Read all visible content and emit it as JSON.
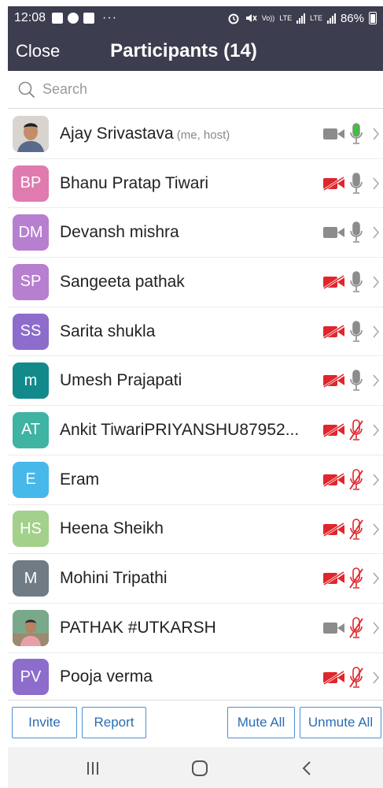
{
  "status_bar": {
    "time": "12:08",
    "dots": "···",
    "volte": "Vo))",
    "lte1": "LTE",
    "lte2": "LTE",
    "battery": "86%"
  },
  "header": {
    "close_label": "Close",
    "title": "Participants (14)"
  },
  "search": {
    "placeholder": "Search"
  },
  "participants": [
    {
      "name": "Ajay Srivastava",
      "tag": "(me, host)",
      "initials": "",
      "avatar_color": "#c8c8c8",
      "photo": true,
      "video_on": true,
      "mic_state": "on"
    },
    {
      "name": "Bhanu Pratap Tiwari",
      "tag": "",
      "initials": "BP",
      "avatar_color": "#e07bb0",
      "photo": false,
      "video_on": false,
      "mic_state": "unmuted"
    },
    {
      "name": "Devansh mishra",
      "tag": "",
      "initials": "DM",
      "avatar_color": "#b77fd0",
      "photo": false,
      "video_on": true,
      "mic_state": "unmuted"
    },
    {
      "name": "Sangeeta pathak",
      "tag": "",
      "initials": "SP",
      "avatar_color": "#b77fd0",
      "photo": false,
      "video_on": false,
      "mic_state": "unmuted"
    },
    {
      "name": "Sarita shukla",
      "tag": "",
      "initials": "SS",
      "avatar_color": "#8e6ccc",
      "photo": false,
      "video_on": false,
      "mic_state": "unmuted"
    },
    {
      "name": "Umesh Prajapati",
      "tag": "",
      "initials": "m",
      "avatar_color": "#128a8c",
      "photo": false,
      "video_on": false,
      "mic_state": "unmuted"
    },
    {
      "name": "Ankit TiwariPRIYANSHU87952...",
      "tag": "",
      "initials": "AT",
      "avatar_color": "#3fb3a4",
      "photo": false,
      "video_on": false,
      "mic_state": "muted"
    },
    {
      "name": "Eram",
      "tag": "",
      "initials": "E",
      "avatar_color": "#47b8ea",
      "photo": false,
      "video_on": false,
      "mic_state": "muted"
    },
    {
      "name": "Heena Sheikh",
      "tag": "",
      "initials": "HS",
      "avatar_color": "#a3d08a",
      "photo": false,
      "video_on": false,
      "mic_state": "muted"
    },
    {
      "name": "Mohini Tripathi",
      "tag": "",
      "initials": "M",
      "avatar_color": "#6f7c86",
      "photo": false,
      "video_on": false,
      "mic_state": "muted"
    },
    {
      "name": "PATHAK #UTKARSH",
      "tag": "",
      "initials": "",
      "avatar_color": "#7aa88a",
      "photo": true,
      "video_on": true,
      "mic_state": "muted"
    },
    {
      "name": "Pooja verma",
      "tag": "",
      "initials": "PV",
      "avatar_color": "#8e6ccc",
      "photo": false,
      "video_on": false,
      "mic_state": "muted"
    }
  ],
  "actions": {
    "invite": "Invite",
    "report": "Report",
    "mute_all": "Mute All",
    "unmute_all": "Unmute All"
  },
  "colors": {
    "header_bg": "#3d3d50",
    "muted_red": "#e0262c",
    "mic_on_green": "#3ec23e",
    "icon_grey": "#8c8c8c",
    "button_blue": "#2a6db4"
  },
  "icons": {
    "status_left": [
      "gallery-icon",
      "whatsapp-icon",
      "image-icon"
    ],
    "status_right": [
      "alarm-icon",
      "mute-icon",
      "signal-icon",
      "battery-icon"
    ],
    "nav": [
      "recent-apps-icon",
      "home-icon",
      "back-icon"
    ]
  }
}
